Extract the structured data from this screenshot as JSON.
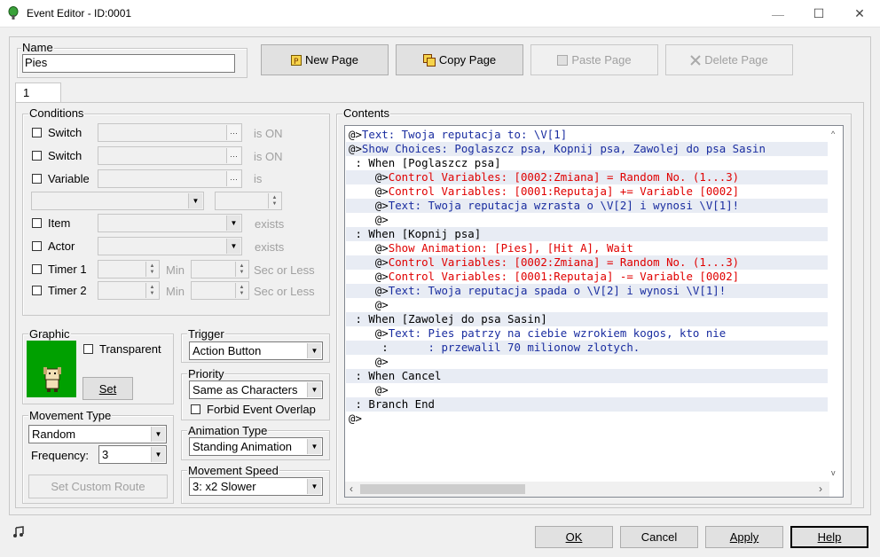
{
  "window": {
    "title": "Event Editor - ID:0001",
    "minimize": "—",
    "maximize": "☐",
    "close": "✕"
  },
  "name": {
    "legend": "Name",
    "value": "Pies"
  },
  "page_buttons": {
    "new": "New Page",
    "copy": "Copy Page",
    "paste": "Paste Page",
    "delete": "Delete Page"
  },
  "tab": {
    "label": "1"
  },
  "conditions": {
    "legend": "Conditions",
    "switch1": {
      "label": "Switch",
      "suffix": "is ON"
    },
    "switch2": {
      "label": "Switch",
      "suffix": "is ON"
    },
    "variable": {
      "label": "Variable",
      "suffix": "is"
    },
    "item": {
      "label": "Item",
      "suffix": "exists"
    },
    "actor": {
      "label": "Actor",
      "suffix": "exists"
    },
    "timer1": {
      "label": "Timer 1",
      "min": "Min",
      "sec": "Sec or Less"
    },
    "timer2": {
      "label": "Timer 2",
      "min": "Min",
      "sec": "Sec or Less"
    }
  },
  "graphic": {
    "legend": "Graphic",
    "transparent": "Transparent",
    "set": "Set"
  },
  "trigger": {
    "legend": "Trigger",
    "value": "Action Button"
  },
  "priority": {
    "legend": "Priority",
    "value": "Same as Characters",
    "forbid": "Forbid Event Overlap"
  },
  "animation_type": {
    "legend": "Animation Type",
    "value": "Standing Animation"
  },
  "movement_speed": {
    "legend": "Movement Speed",
    "value": "3: x2 Slower"
  },
  "movement_type": {
    "legend": "Movement Type",
    "value": "Random",
    "frequency_label": "Frequency:",
    "frequency": "3",
    "custom_route": "Set Custom Route"
  },
  "contents": {
    "legend": "Contents",
    "lines": [
      {
        "prefix": "@>",
        "text": "Text: Twoja reputacja to: \\V[1]",
        "color": "blue"
      },
      {
        "prefix": "@>",
        "text": "Show Choices: Poglaszcz psa, Kopnij psa, Zawolej do psa Sasin",
        "color": "blue"
      },
      {
        "prefix": " : ",
        "text": "When [Poglaszcz psa]",
        "color": "black"
      },
      {
        "prefix": "    @>",
        "text": "Control Variables: [0002:Zmiana] = Random No. (1...3)",
        "color": "red"
      },
      {
        "prefix": "    @>",
        "text": "Control Variables: [0001:Reputaja] += Variable [0002]",
        "color": "red"
      },
      {
        "prefix": "    @>",
        "text": "Text: Twoja reputacja wzrasta o \\V[2] i wynosi \\V[1]!",
        "color": "blue"
      },
      {
        "prefix": "    @>",
        "text": "",
        "color": "black"
      },
      {
        "prefix": " : ",
        "text": "When [Kopnij psa]",
        "color": "black"
      },
      {
        "prefix": "    @>",
        "text": "Show Animation: [Pies], [Hit A], Wait",
        "color": "red"
      },
      {
        "prefix": "    @>",
        "text": "Control Variables: [0002:Zmiana] = Random No. (1...3)",
        "color": "red"
      },
      {
        "prefix": "    @>",
        "text": "Control Variables: [0001:Reputaja] -= Variable [0002]",
        "color": "red"
      },
      {
        "prefix": "    @>",
        "text": "Text: Twoja reputacja spada o \\V[2] i wynosi \\V[1]!",
        "color": "blue"
      },
      {
        "prefix": "    @>",
        "text": "",
        "color": "black"
      },
      {
        "prefix": " : ",
        "text": "When [Zawolej do psa Sasin]",
        "color": "black"
      },
      {
        "prefix": "    @>",
        "text": "Text: Pies patrzy na ciebie wzrokiem kogos, kto nie",
        "color": "blue"
      },
      {
        "prefix": "     :      ",
        "text": ": przewalil 70 milionow zlotych.",
        "color": "blue"
      },
      {
        "prefix": "    @>",
        "text": "",
        "color": "black"
      },
      {
        "prefix": " : ",
        "text": "When Cancel",
        "color": "black"
      },
      {
        "prefix": "    @>",
        "text": "",
        "color": "black"
      },
      {
        "prefix": " : ",
        "text": "Branch End",
        "color": "black"
      },
      {
        "prefix": "@>",
        "text": "",
        "color": "black"
      }
    ]
  },
  "footer": {
    "ok": "OK",
    "cancel": "Cancel",
    "apply": "Apply",
    "help": "Help"
  },
  "colors": {
    "blue": "#1a2da0",
    "red": "#e00000",
    "black": "#000000",
    "graphic_bg": "#00a000"
  }
}
